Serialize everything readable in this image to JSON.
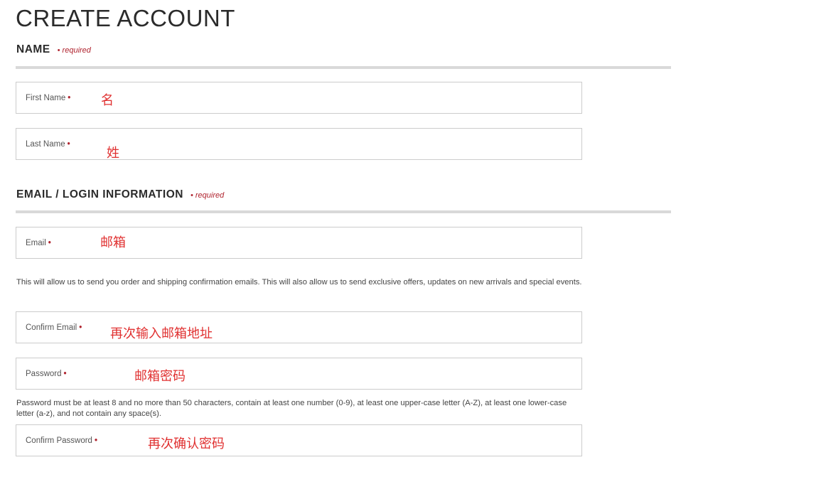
{
  "page": {
    "title": "CREATE ACCOUNT"
  },
  "sections": {
    "name": {
      "heading": "NAME",
      "required": "• required"
    },
    "login": {
      "heading": "EMAIL / LOGIN INFORMATION",
      "required": "• required"
    }
  },
  "fields": {
    "first_name": {
      "label": "First Name",
      "value": "名"
    },
    "last_name": {
      "label": "Last Name",
      "value": "姓"
    },
    "email": {
      "label": "Email",
      "value": "邮箱"
    },
    "confirm_email": {
      "label": "Confirm Email",
      "value": "再次输入邮箱地址"
    },
    "password": {
      "label": "Password",
      "value": "邮箱密码"
    },
    "confirm_password": {
      "label": "Confirm Password",
      "value": "再次确认密码"
    }
  },
  "required_marker": "•",
  "help": {
    "email": "This will allow us to send you order and shipping confirmation emails.   This will also allow us to send exclusive offers, updates on new arrivals and special events.",
    "password": "Password must be at least 8 and no more than 50 characters, contain at least one number (0-9), at least one upper-case letter (A-Z), at least one lower-case letter (a-z), and not contain any space(s)."
  },
  "colors": {
    "accent": "#b0242f",
    "annotation": "#e03030",
    "rule": "#d9d9d9",
    "border": "#cccccc"
  }
}
